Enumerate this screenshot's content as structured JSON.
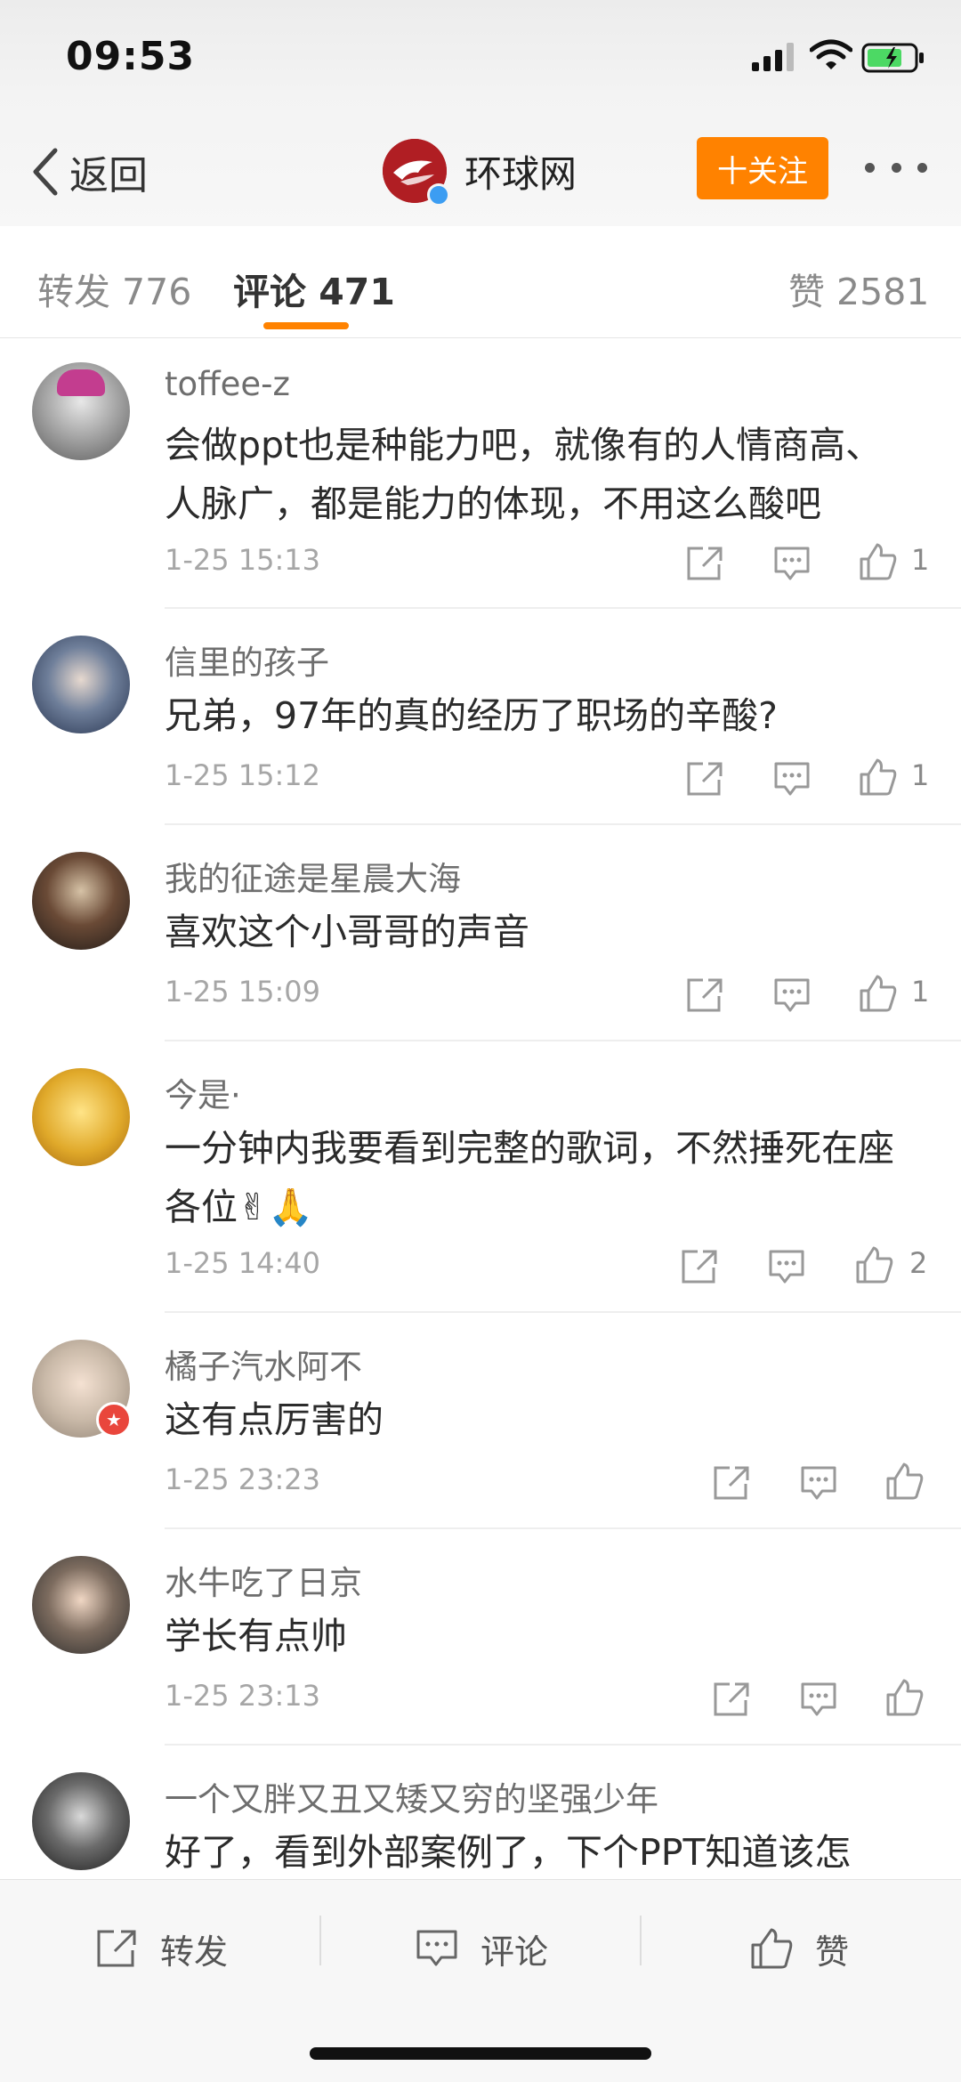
{
  "status_bar": {
    "time": "09:53"
  },
  "header": {
    "back_label": "返回",
    "account_name": "环球网",
    "follow_label": "十关注",
    "brand_color": "#b01e23",
    "accent_color": "#ff8200"
  },
  "tabs": {
    "repost": "转发 776",
    "comment": "评论 471",
    "like": "赞 2581"
  },
  "comments": [
    {
      "username": "toffee-z",
      "text": "会做ppt也是种能力吧，就像有的人情商高、人脉广，都是能力的体现，不用这么酸吧",
      "time": "1-25 15:13",
      "likes": "1"
    },
    {
      "username": "信里的孩子",
      "text": "兄弟，97年的真的经历了职场的辛酸?",
      "time": "1-25 15:12",
      "likes": "1"
    },
    {
      "username": "我的征途是星晨大海",
      "text": "喜欢这个小哥哥的声音",
      "time": "1-25 15:09",
      "likes": "1"
    },
    {
      "username": "今是·",
      "text": "一分钟内我要看到完整的歌词，不然捶死在座各位✌🙏",
      "time": "1-25 14:40",
      "likes": "2"
    },
    {
      "username": "橘子汽水阿不",
      "text": "这有点厉害的",
      "time": "1-25 23:23",
      "likes": ""
    },
    {
      "username": "水牛吃了日京",
      "text": "学长有点帅",
      "time": "1-25 23:13",
      "likes": ""
    },
    {
      "username": "一个又胖又丑又矮又穷的坚强少年",
      "text": "好了，看到外部案例了，下个PPT知道该怎",
      "time": "",
      "likes": ""
    }
  ],
  "bottom_bar": {
    "repost_label": "转发",
    "comment_label": "评论",
    "like_label": "赞"
  },
  "icons": [
    "signal-icon",
    "wifi-icon",
    "battery-icon",
    "back-chevron-icon",
    "more-icon",
    "share-icon",
    "comment-icon",
    "like-icon"
  ]
}
